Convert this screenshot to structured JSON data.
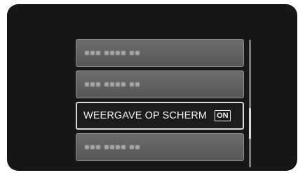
{
  "menu": {
    "items": [
      {
        "type": "blurred"
      },
      {
        "type": "blurred"
      },
      {
        "type": "selected",
        "label": "WEERGAVE OP SCHERM",
        "value": "ON"
      },
      {
        "type": "blurred"
      }
    ]
  },
  "colors": {
    "screen_bg": "#171717",
    "item_bg": "#616161",
    "selected_bg": "#1c1c1c",
    "text": "#f2f2f2"
  }
}
